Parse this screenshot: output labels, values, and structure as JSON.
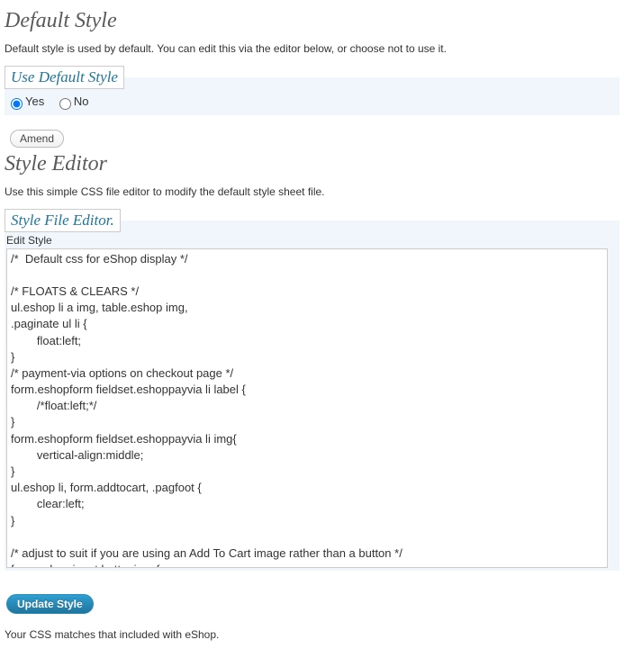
{
  "section1": {
    "title": "Default Style",
    "desc": "Default style is used by default. You can edit this via the editor below, or choose not to use it.",
    "legend": "Use Default Style",
    "yes_label": "Yes",
    "no_label": "No",
    "yes_checked": true,
    "amend_label": "Amend"
  },
  "section2": {
    "title": "Style Editor",
    "desc": "Use this simple CSS file editor to modify the default style sheet file.",
    "legend": "Style File Editor.",
    "edit_label": "Edit Style",
    "editor_content": "/*  Default css for eShop display */\n\n/* FLOATS & CLEARS */\nul.eshop li a img, table.eshop img,\n.paginate ul li {\n\tfloat:left;\n}\n/* payment-via options on checkout page */\nform.eshopform fieldset.eshoppayvia li label {\n\t/*float:left;*/\n}\nform.eshopform fieldset.eshoppayvia li img{\n\tvertical-align:middle;\n}\nul.eshop li, form.addtocart, .pagfoot {\n\tclear:left;\n}\n\n/* adjust to suit if you are using an Add To Cart image rather than a button */\nform.eshop input.buttonimg {",
    "update_label": "Update Style"
  },
  "status_msg": "Your CSS matches that included with eShop."
}
